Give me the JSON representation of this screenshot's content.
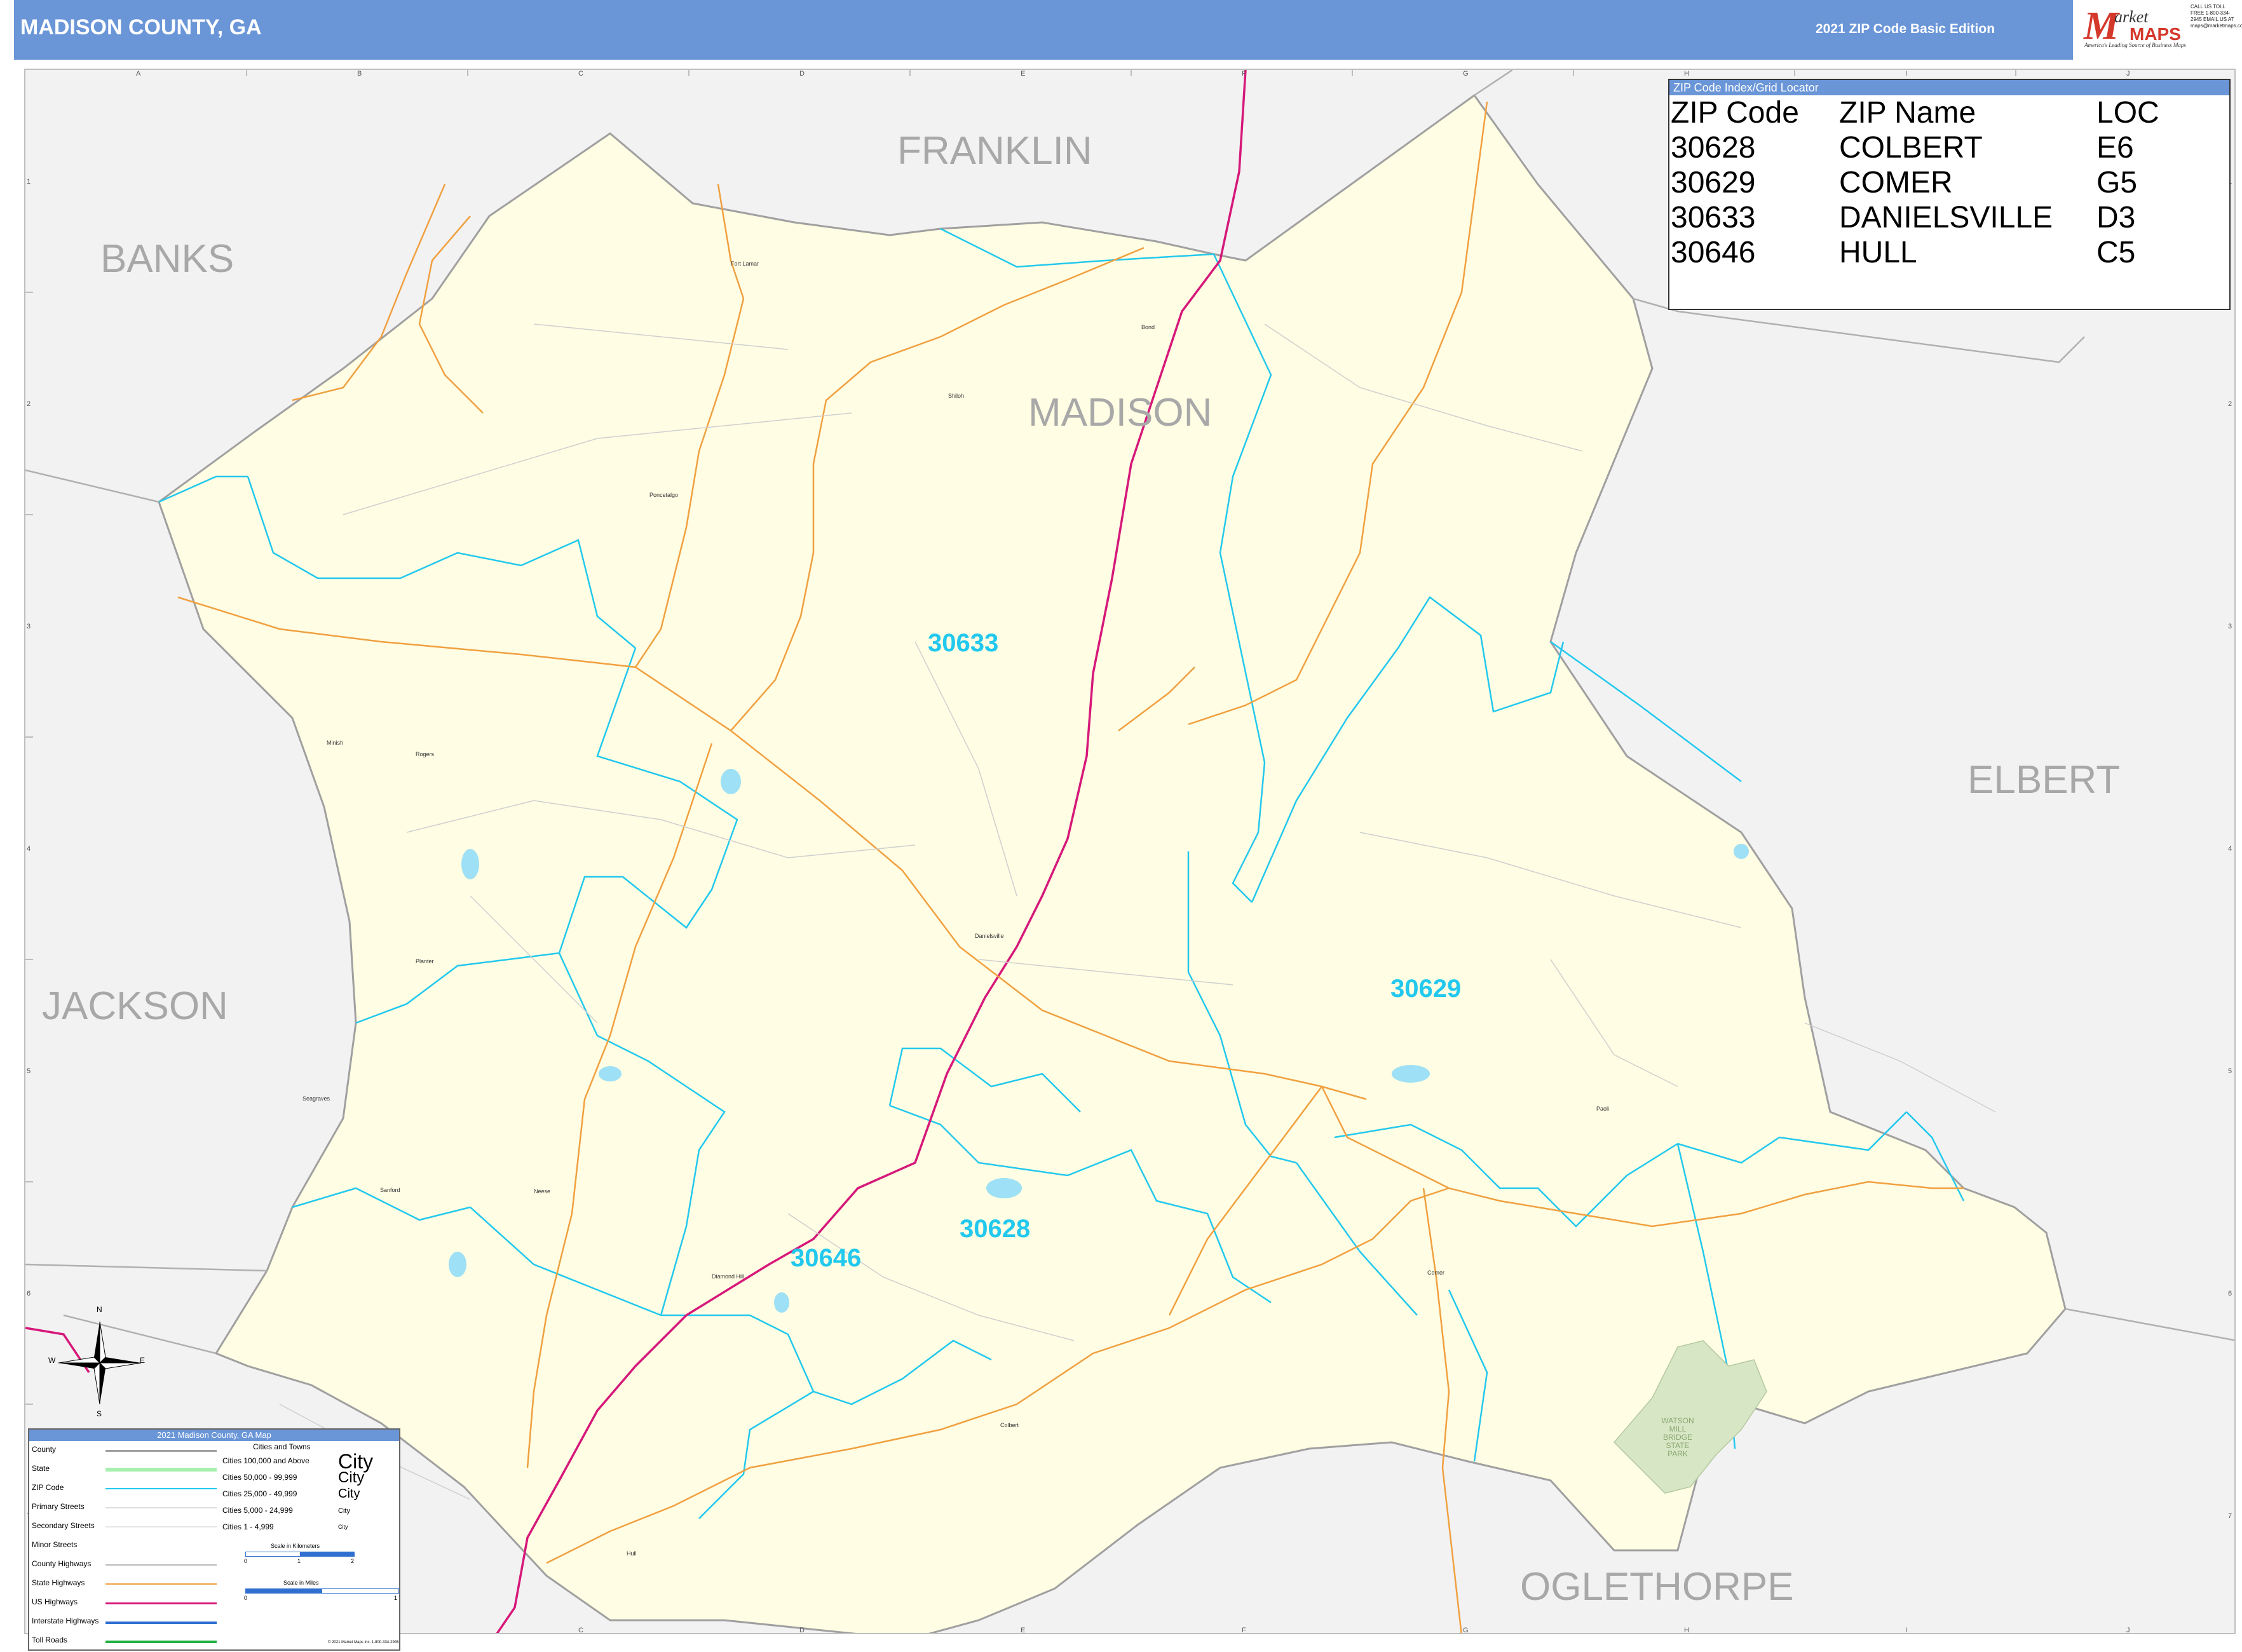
{
  "header": {
    "title": "MADISON COUNTY, GA",
    "edition": "2021 ZIP Code Basic Edition"
  },
  "logo": {
    "brand_m": "M",
    "brand_arket": "arket",
    "brand_maps": "MAPS",
    "tagline": "America's Leading Source of Business Maps",
    "contact": "CALL US TOLL FREE 1-800-334-2945 EMAIL US AT maps@marketmaps.com"
  },
  "grid": {
    "columns": [
      "A",
      "B",
      "C",
      "D",
      "E",
      "F",
      "G",
      "H",
      "I",
      "J"
    ],
    "rows": [
      "1",
      "2",
      "3",
      "4",
      "5",
      "6",
      "7"
    ]
  },
  "counties": {
    "franklin": "FRANKLIN",
    "banks": "BANKS",
    "madison": "MADISON",
    "elbert": "ELBERT",
    "jackson": "JACKSON",
    "oglethorpe": "OGLETHORPE"
  },
  "zip_labels": {
    "z30633": "30633",
    "z30629": "30629",
    "z30628": "30628",
    "z30646": "30646"
  },
  "places": {
    "fort_lamar": "Fort Lamar",
    "bond": "Bond",
    "shiloh": "Shiloh",
    "poncetalgo": "Poncetalgo",
    "minish": "Minish",
    "rogers": "Rogers",
    "danielsville": "Danielsville",
    "planter": "Planter",
    "seagraves": "Seagraves",
    "sanford": "Sanford",
    "neese": "Neese",
    "diamond_hill": "Diamond Hill",
    "paoli": "Paoli",
    "comer": "Comer",
    "colbert": "Colbert",
    "hull": "Hull"
  },
  "park": {
    "label_lines": [
      "WATSON",
      "MILL",
      "BRIDGE",
      "STATE",
      "PARK"
    ]
  },
  "zip_index": {
    "title": "ZIP Code Index/Grid Locator",
    "headers": [
      "ZIP Code",
      "ZIP Name",
      "LOC"
    ],
    "rows": [
      [
        "30628",
        "COLBERT",
        "E6"
      ],
      [
        "30629",
        "COMER",
        "G5"
      ],
      [
        "30633",
        "DANIELSVILLE",
        "D3"
      ],
      [
        "30646",
        "HULL",
        "C5"
      ]
    ]
  },
  "legend": {
    "title": "2021 Madison County, GA Map",
    "items": [
      "County",
      "State",
      "ZIP Code",
      "Primary Streets",
      "Secondary Streets",
      "Minor Streets",
      "County Highways",
      "State Highways",
      "US Highways",
      "Interstate Highways",
      "Toll Roads"
    ],
    "cities_heading": "Cities and Towns",
    "city_sizes": [
      "Cities 100,000 and Above",
      "Cities 50,000 - 99,999",
      "Cities 25,000 - 49,999",
      "Cities 5,000 - 24,999",
      "Cities 1 - 4,999"
    ],
    "city_glyph": "City",
    "scale_km": "Scale in Kilometers",
    "scale_mi": "Scale in Miles",
    "scale_km_ticks": [
      "0",
      "1",
      "2"
    ],
    "scale_mi_ticks": [
      "0",
      "1"
    ],
    "credit": "© 2021 Market Maps Inc. 1-800-334-2945"
  },
  "compass": {
    "n": "N",
    "s": "S",
    "e": "E",
    "w": "W"
  },
  "colors": {
    "header_bg": "#6a96d8",
    "county_fill": "#fffde3",
    "zip_line": "#22c8ee",
    "us_highway": "#d6187a",
    "state_highway": "#f0a040",
    "county_label": "#a8a8a8"
  }
}
